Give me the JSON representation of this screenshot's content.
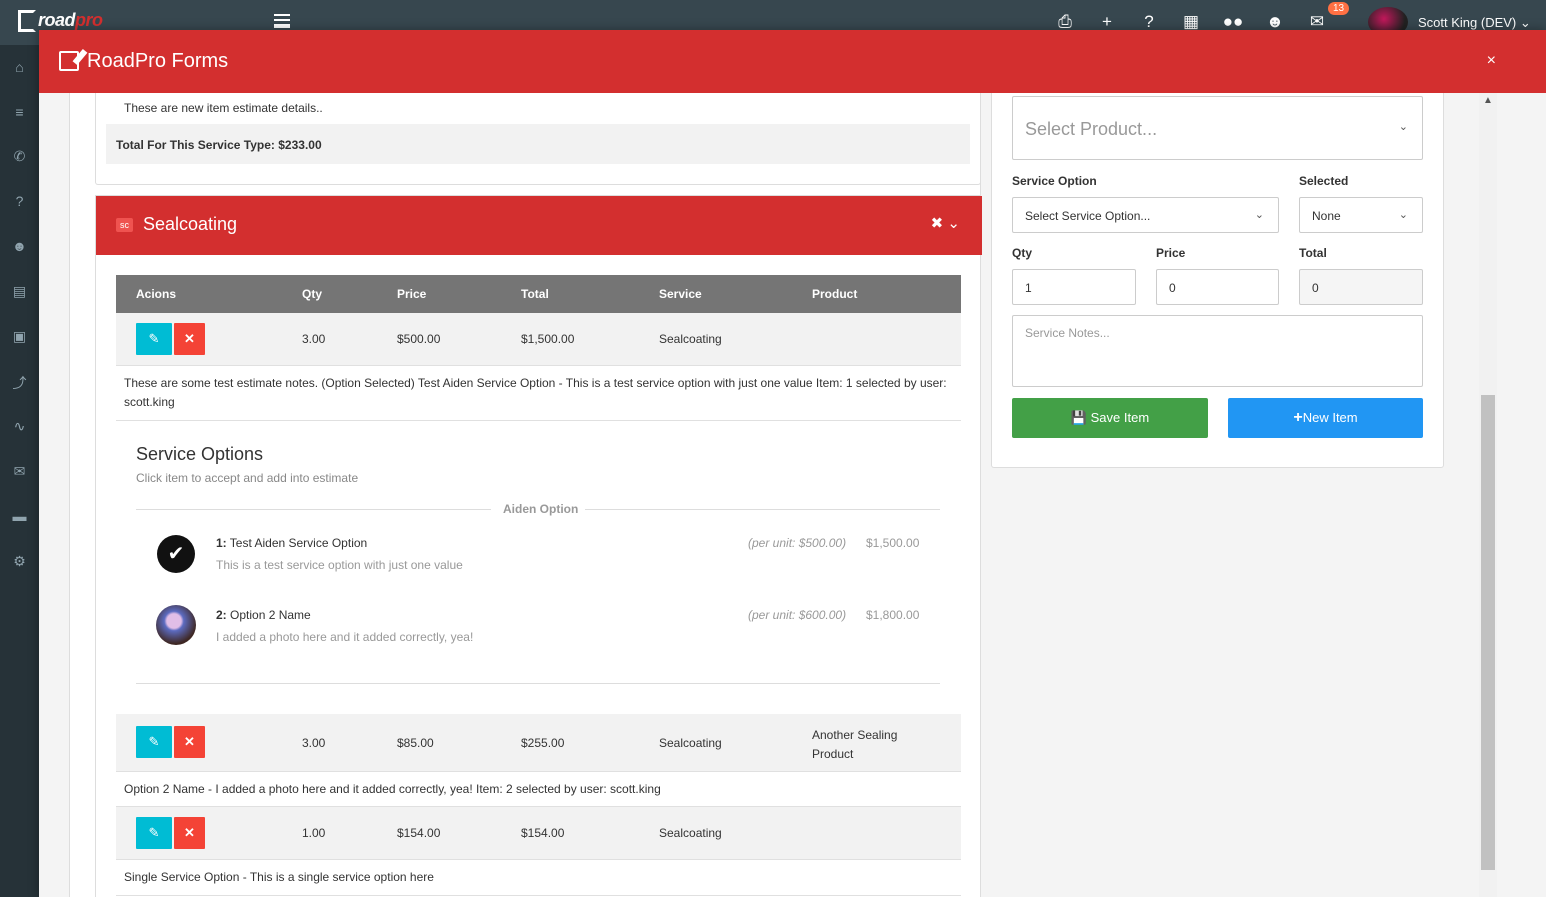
{
  "app": {
    "logo_road": "road",
    "logo_pro": "pro",
    "user_name": "Scott King (DEV)",
    "notification_count": "13"
  },
  "modal": {
    "title": "RoadPro Forms",
    "close": "×"
  },
  "previous_section": {
    "note": "These are new item estimate details..",
    "total": "Total For This Service Type: $233.00"
  },
  "section": {
    "badge": "sc",
    "title": "Sealcoating",
    "columns": [
      "Acions",
      "Qty",
      "Price",
      "Total",
      "Service",
      "Product"
    ],
    "rows": [
      {
        "qty": "3.00",
        "price": "$500.00",
        "total": "$1,500.00",
        "service": "Sealcoating",
        "product": "",
        "note": "These are some test estimate notes. (Option Selected) Test Aiden Service Option - This is a test service option with just one value Item: 1 selected by user: scott.king"
      },
      {
        "qty": "3.00",
        "price": "$85.00",
        "total": "$255.00",
        "service": "Sealcoating",
        "product": "Another Sealing Product",
        "note": "Option 2 Name - I added a photo here and it added correctly, yea! Item: 2 selected by user: scott.king"
      },
      {
        "qty": "1.00",
        "price": "$154.00",
        "total": "$154.00",
        "service": "Sealcoating",
        "product": "",
        "note": "Single Service Option - This is a single service option here"
      }
    ],
    "service_options": {
      "title": "Service Options",
      "subtitle": "Click item to accept and add into estimate",
      "group": "Aiden Option",
      "options": [
        {
          "num": "1:",
          "name": "Test Aiden Service Option",
          "desc": "This is a test service option with just one value",
          "unit": "(per unit: $500.00)",
          "total": "$1,500.00"
        },
        {
          "num": "2:",
          "name": "Option 2 Name",
          "desc": "I added a photo here and it added correctly, yea!",
          "unit": "(per unit: $600.00)",
          "total": "$1,800.00"
        }
      ]
    }
  },
  "form": {
    "product_placeholder": "Select Product...",
    "service_option_label": "Service Option",
    "service_option_value": "Select Service Option...",
    "selected_label": "Selected",
    "selected_value": "None",
    "qty_label": "Qty",
    "qty_value": "1",
    "price_label": "Price",
    "price_value": "0",
    "total_label": "Total",
    "total_value": "0",
    "notes_placeholder": "Service Notes...",
    "save_label": "Save Item",
    "new_label": "New Item"
  },
  "colors": {
    "primary_red": "#d32f2f",
    "save_green": "#43a047",
    "new_blue": "#2196f3",
    "edit_cyan": "#00bcd4",
    "delete_red": "#f44336"
  }
}
